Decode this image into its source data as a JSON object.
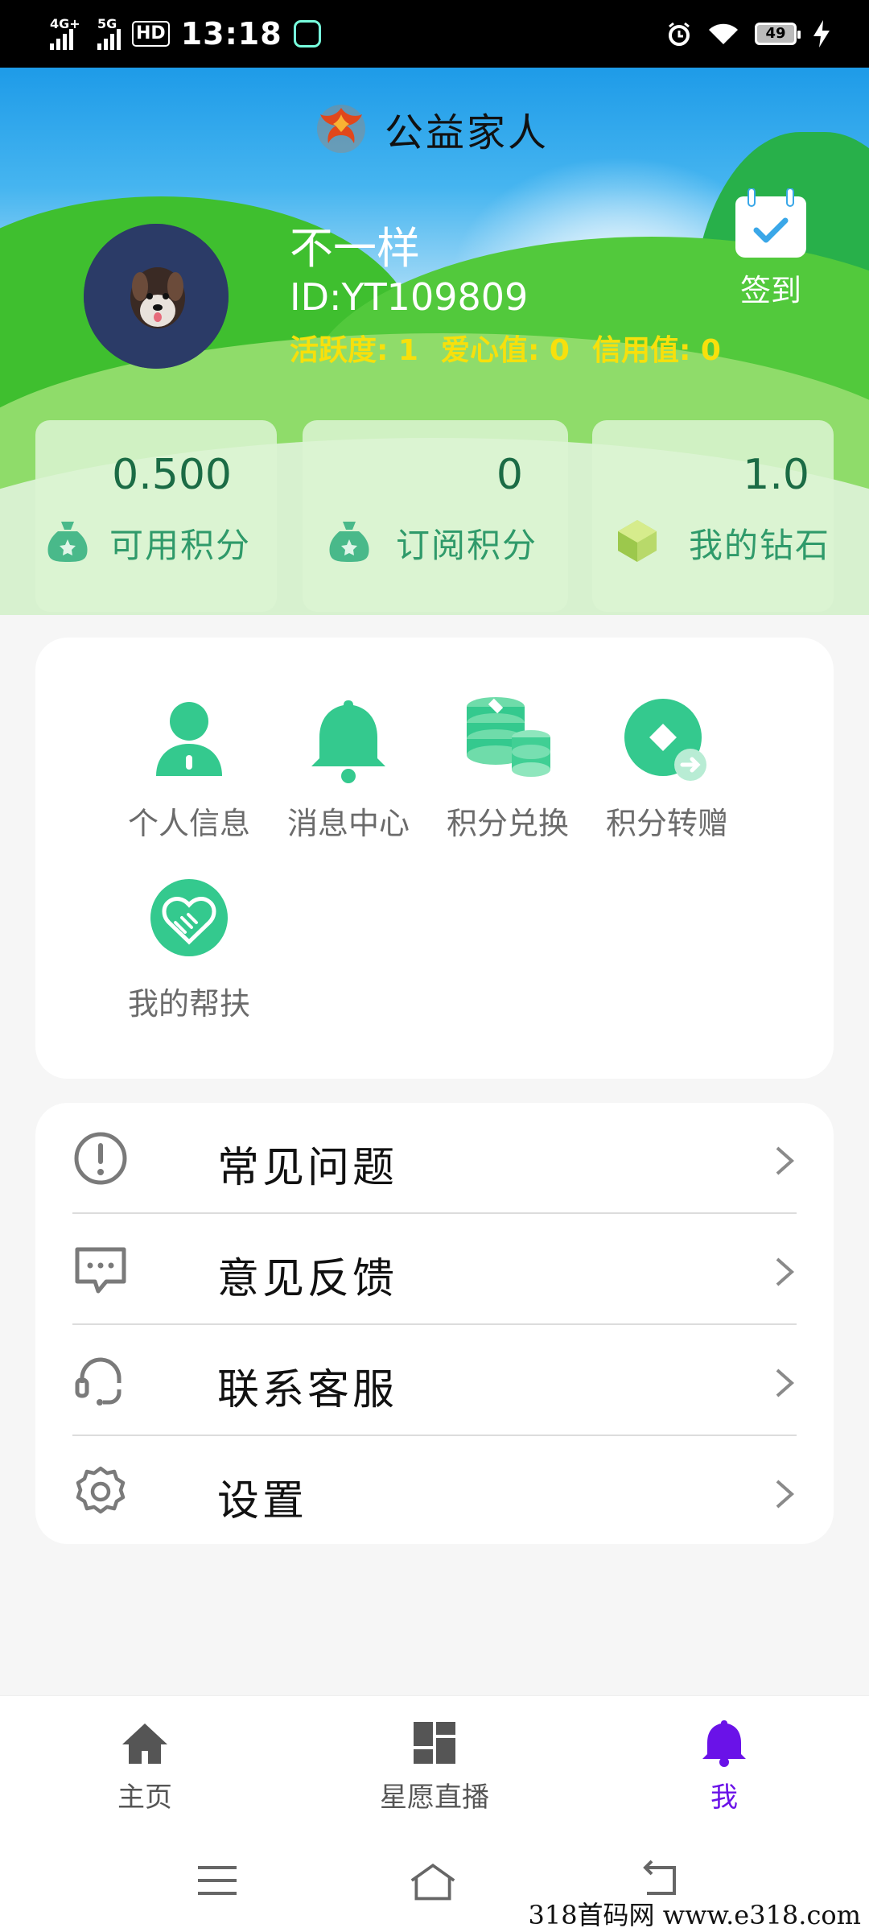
{
  "status_bar": {
    "net1": "4G+",
    "net2": "5G",
    "hd": "HD",
    "time": "13:18",
    "battery": "49"
  },
  "header": {
    "app_title": "公益家人",
    "username": "不一样",
    "user_id": "ID:YT109809",
    "activity": "活跃度: 1",
    "love": "爱心值: 0",
    "credit": "信用值: 0",
    "checkin_label": "签到"
  },
  "cards": [
    {
      "value": "0.500",
      "label": "可用积分",
      "icon": "money-bag-icon"
    },
    {
      "value": "0",
      "label": "订阅积分",
      "icon": "money-bag-icon"
    },
    {
      "value": "1.0",
      "label": "我的钻石",
      "icon": "gem-icon"
    }
  ],
  "features": [
    {
      "label": "个人信息",
      "icon": "person-icon"
    },
    {
      "label": "消息中心",
      "icon": "bell-icon"
    },
    {
      "label": "积分兑换",
      "icon": "coin-stack-icon"
    },
    {
      "label": "积分转赠",
      "icon": "transfer-icon"
    },
    {
      "label": "我的帮扶",
      "icon": "handshake-heart-icon"
    }
  ],
  "menu": [
    {
      "label": "常见问题",
      "icon": "info-circle-icon"
    },
    {
      "label": "意见反馈",
      "icon": "chat-bubble-icon"
    },
    {
      "label": "联系客服",
      "icon": "headset-icon"
    },
    {
      "label": "设置",
      "icon": "gear-icon"
    }
  ],
  "bottom_nav": [
    {
      "label": "主页",
      "icon": "home-icon"
    },
    {
      "label": "星愿直播",
      "icon": "dashboard-icon"
    },
    {
      "label": "我",
      "icon": "bell-icon",
      "active": true
    }
  ],
  "watermark": "318首码网 www.e318.com",
  "colors": {
    "accent_green": "#2fc38a",
    "active_purple": "#6a12e8",
    "stat_yellow": "#f7e00c"
  }
}
